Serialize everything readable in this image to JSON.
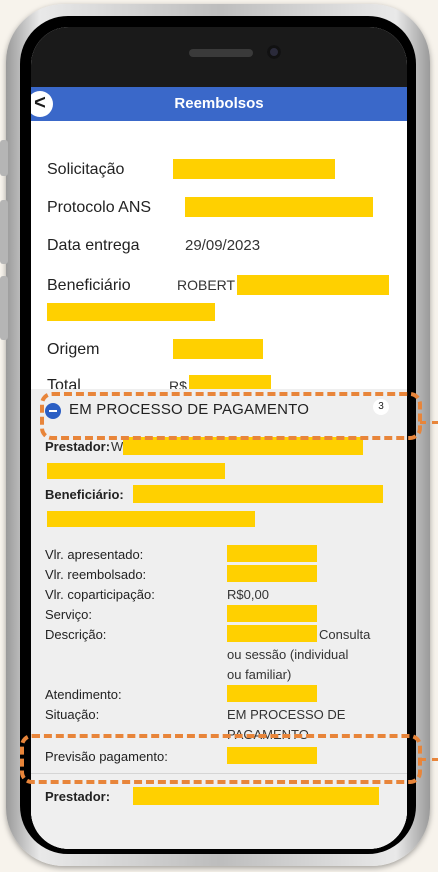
{
  "header": {
    "back_icon": "chevron-left-icon",
    "back_label": "<",
    "title": "Reembolsos"
  },
  "summary": {
    "solicitacao_label": "Solicitação",
    "protocolo_label": "Protocolo ANS",
    "data_label": "Data entrega",
    "data_value": "29/09/2023",
    "beneficiario_label": "Beneficiário",
    "beneficiario_value": "ROBERT",
    "origem_label": "Origem",
    "total_label": "Total",
    "total_value": "R$"
  },
  "section": {
    "title": "EM PROCESSO DE PAGAMENTO",
    "count": "3",
    "prestador_label": "Prestador:",
    "prestador_value": "W",
    "beneficiario_label": "Beneficiário:",
    "vlr_apresentado_label": "Vlr. apresentado:",
    "vlr_reembolsado_label": "Vlr. reembolsado:",
    "vlr_coparticipacao_label": "Vlr. coparticipação:",
    "vlr_coparticipacao_value": "R$0,00",
    "servico_label": "Serviço:",
    "descricao_label": "Descrição:",
    "descricao_line1": "Consulta",
    "descricao_line2": "ou sessão (individual",
    "descricao_line3": "ou familiar)",
    "atendimento_label": "Atendimento:",
    "situacao_label": "Situação:",
    "situacao_line1": "EM PROCESSO DE",
    "situacao_line2": "PAGAMENTO",
    "previsao_label": "Previsão pagamento:",
    "prestador2_label": "Prestador:"
  },
  "colors": {
    "accent": "#3a68c9",
    "redaction": "#ffd000",
    "highlight": "#e8853a"
  }
}
